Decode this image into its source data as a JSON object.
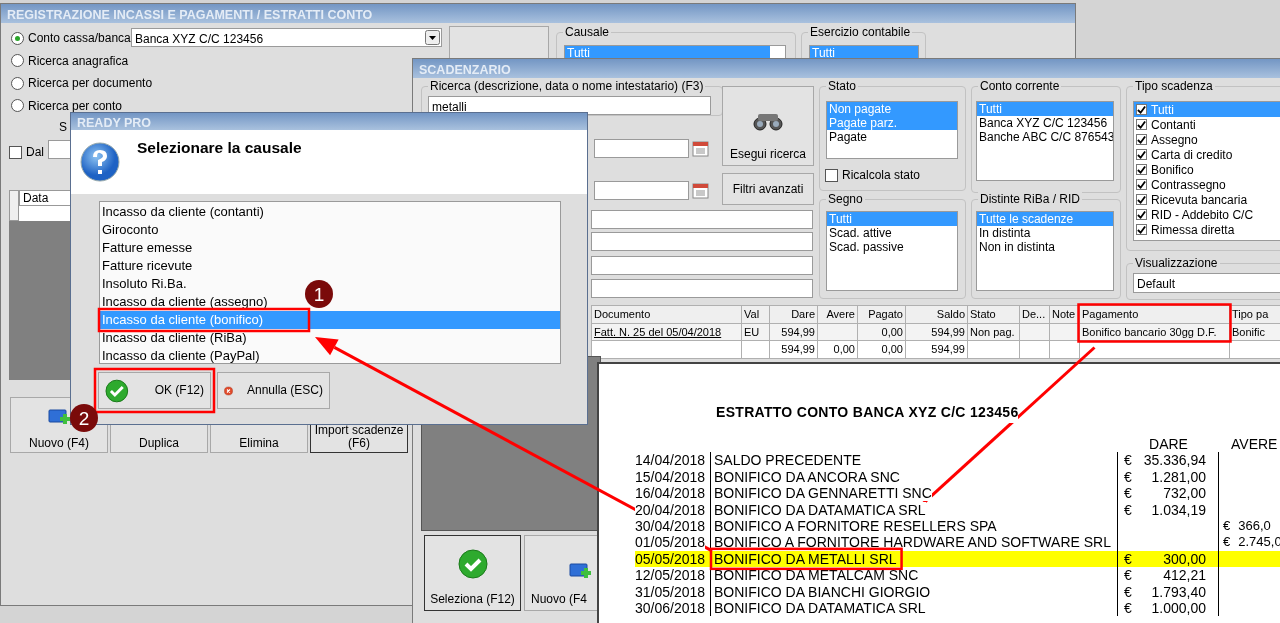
{
  "main_window": {
    "title": "REGISTRAZIONE INCASSI E PAGAMENTI / ESTRATTI CONTO",
    "search_modes": [
      {
        "label": "Conto cassa/banca",
        "selected": true
      },
      {
        "label": "Ricerca anagrafica",
        "selected": false
      },
      {
        "label": "Ricerca per documento",
        "selected": false
      },
      {
        "label": "Ricerca per conto",
        "selected": false
      }
    ],
    "account": "Banca XYZ C/C 123456",
    "partial_label": "S",
    "date_from": {
      "label": "Dal",
      "checked": false
    },
    "causale": {
      "label": "Causale",
      "value": "Tutti"
    },
    "esercizio": {
      "label": "Esercizio contabile",
      "value": "Tutti"
    },
    "table_columns": [
      "Data"
    ],
    "buttons": [
      {
        "label": "Nuovo (F4)",
        "kind": "new"
      },
      {
        "label": "Duplica",
        "kind": "plain"
      },
      {
        "label": "Elimina",
        "kind": "plain"
      },
      {
        "label": "Import scadenze (F6)",
        "kind": "plain"
      }
    ]
  },
  "scadenzario": {
    "title": "SCADENZARIO",
    "search": {
      "label": "Ricerca (descrizione, data o nome intestatario) (F3)",
      "value": "metalli"
    },
    "search_button": "Esegui ricerca",
    "filters_button": "Filtri avanzati",
    "stato": {
      "label": "Stato",
      "items": [
        {
          "label": "Non pagate",
          "selected": true
        },
        {
          "label": "Pagate parz.",
          "selected": true
        },
        {
          "label": "Pagate",
          "selected": false
        }
      ]
    },
    "recalc": {
      "label": "Ricalcola stato",
      "checked": false
    },
    "conto": {
      "label": "Conto corrente",
      "items": [
        {
          "label": "Tutti",
          "selected": true
        },
        {
          "label": "Banca XYZ C/C 123456",
          "selected": false
        },
        {
          "label": "Banche ABC C/C 876543",
          "selected": false
        }
      ]
    },
    "segno": {
      "label": "Segno",
      "items": [
        {
          "label": "Tutti",
          "selected": true
        },
        {
          "label": "Scad. attive",
          "selected": false
        },
        {
          "label": "Scad. passive",
          "selected": false
        }
      ]
    },
    "distinte": {
      "label": "Distinte RiBa / RID",
      "items": [
        {
          "label": "Tutte le scadenze",
          "selected": true
        },
        {
          "label": "In distinta",
          "selected": false
        },
        {
          "label": "Non in distinta",
          "selected": false
        }
      ]
    },
    "tipo": {
      "label": "Tipo scadenza",
      "items": [
        {
          "label": "Tutti",
          "checked": true,
          "selected": true
        },
        {
          "label": "Contanti",
          "checked": true,
          "selected": false
        },
        {
          "label": "Assegno",
          "checked": true,
          "selected": false
        },
        {
          "label": "Carta di credito",
          "checked": true,
          "selected": false
        },
        {
          "label": "Bonifico",
          "checked": true,
          "selected": false
        },
        {
          "label": "Contrassegno",
          "checked": true,
          "selected": false
        },
        {
          "label": "Ricevuta bancaria",
          "checked": true,
          "selected": false
        },
        {
          "label": "RID - Addebito C/C",
          "checked": true,
          "selected": false
        },
        {
          "label": "Rimessa diretta",
          "checked": true,
          "selected": false
        }
      ]
    },
    "visualizzazione": {
      "label": "Visualizzazione",
      "value": "Default"
    },
    "table": {
      "columns": [
        "Documento",
        "Val",
        "Dare",
        "Avere",
        "Pagato",
        "Saldo",
        "Stato",
        "De...",
        "Note",
        "Pagamento",
        "Tipo pa"
      ],
      "rows": [
        [
          "Fatt. N. 25 del 05/04/2018",
          "EU",
          "594,99",
          "",
          "0,00",
          "594,99",
          "Non pag.",
          "",
          "",
          "Bonifico bancario 30gg D.F.",
          "Bonific"
        ],
        [
          "",
          "",
          "594,99",
          "0,00",
          "0,00",
          "594,99",
          "",
          "",
          "",
          "",
          ""
        ]
      ]
    },
    "buttons": [
      {
        "label": "Seleziona (F12)",
        "kind": "select"
      },
      {
        "label": "Nuovo (F4",
        "kind": "new"
      }
    ]
  },
  "dialog": {
    "title": "READY PRO",
    "heading": "Selezionare la causale",
    "items": [
      {
        "label": "Incasso da cliente (contanti)",
        "selected": false
      },
      {
        "label": "Giroconto",
        "selected": false
      },
      {
        "label": "Fatture emesse",
        "selected": false
      },
      {
        "label": "Fatture ricevute",
        "selected": false
      },
      {
        "label": "Insoluto Ri.Ba.",
        "selected": false
      },
      {
        "label": "Incasso da cliente (assegno)",
        "selected": false
      },
      {
        "label": "Incasso da cliente (bonifico)",
        "selected": true
      },
      {
        "label": "Incasso da cliente (RiBa)",
        "selected": false
      },
      {
        "label": "Incasso da cliente (PayPal)",
        "selected": false
      }
    ],
    "buttons": [
      {
        "label": "OK (F12)",
        "kind": "ok"
      },
      {
        "label": "Annulla (ESC)",
        "kind": "cancel"
      }
    ]
  },
  "statement": {
    "title": "ESTRATTO CONTO BANCA XYZ C/C 123456",
    "dare_header": "DARE",
    "avere_header": "AVERE",
    "rows": [
      {
        "date": "14/04/2018",
        "description": "SALDO PRECEDENTE",
        "dare_currency": "€",
        "dare": "35.336,94",
        "highlighted": false
      },
      {
        "date": "15/04/2018",
        "description": "BONIFICO DA ANCORA SNC",
        "dare_currency": "€",
        "dare": "1.281,00",
        "highlighted": false
      },
      {
        "date": "16/04/2018",
        "description": "BONIFICO DA GENNARETTI SNC",
        "dare_currency": "€",
        "dare": "732,00",
        "highlighted": false
      },
      {
        "date": "20/04/2018",
        "description": "BONIFICO DA DATAMATICA SRL",
        "dare_currency": "€",
        "dare": "1.034,19",
        "highlighted": false
      },
      {
        "date": "30/04/2018",
        "description": "BONIFICO A FORNITORE RESELLERS SPA",
        "avere_currency": "€",
        "avere": "366,0",
        "highlighted": false
      },
      {
        "date": "01/05/2018",
        "description": "BONIFICO A FORNITORE HARDWARE AND SOFTWARE SRL",
        "avere_currency": "€",
        "avere": "2.745,0",
        "highlighted": false
      },
      {
        "date": "05/05/2018",
        "description": "BONIFICO DA METALLI SRL",
        "dare_currency": "€",
        "dare": "300,00",
        "highlighted": true
      },
      {
        "date": "12/05/2018",
        "description": "BONIFICO DA METALCAM SNC",
        "dare_currency": "€",
        "dare": "412,21",
        "highlighted": false
      },
      {
        "date": "31/05/2018",
        "description": "BONIFICO DA BIANCHI GIORGIO",
        "dare_currency": "€",
        "dare": "1.793,40",
        "highlighted": false
      },
      {
        "date": "30/06/2018",
        "description": "BONIFICO DA DATAMATICA SRL",
        "dare_currency": "€",
        "dare": "1.000,00",
        "highlighted": false
      }
    ]
  },
  "annotations": {
    "markers": [
      "1",
      "2"
    ]
  }
}
